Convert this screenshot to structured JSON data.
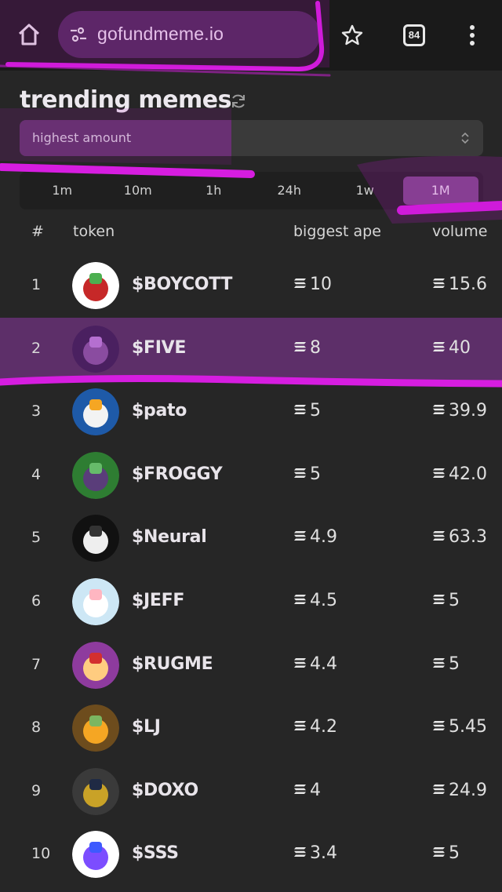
{
  "browser": {
    "url": "gofundmeme.io",
    "tab_count": "84",
    "icons": [
      "home-icon",
      "tune-icon",
      "star-icon",
      "tabs-icon",
      "more-vert-icon"
    ]
  },
  "page": {
    "title": "trending memes",
    "sort_select": {
      "value": "highest amount"
    },
    "timeframes": [
      "1m",
      "10m",
      "1h",
      "24h",
      "1w",
      "1M"
    ],
    "active_timeframe": "1M"
  },
  "table": {
    "headers": {
      "rank": "#",
      "token": "token",
      "ape": "biggest ape",
      "volume": "volume"
    },
    "rows": [
      {
        "rank": "1",
        "name": "$BOYCOTT",
        "ape": "10",
        "volume": "15.6"
      },
      {
        "rank": "2",
        "name": "$FIVE",
        "ape": "8",
        "volume": "40"
      },
      {
        "rank": "3",
        "name": "$pato",
        "ape": "5",
        "volume": "39.9"
      },
      {
        "rank": "4",
        "name": "$FROGGY",
        "ape": "5",
        "volume": "42.0"
      },
      {
        "rank": "5",
        "name": "$Neural",
        "ape": "4.9",
        "volume": "63.3"
      },
      {
        "rank": "6",
        "name": "$JEFF",
        "ape": "4.5",
        "volume": "5"
      },
      {
        "rank": "7",
        "name": "$RUGME",
        "ape": "4.4",
        "volume": "5"
      },
      {
        "rank": "8",
        "name": "$LJ",
        "ape": "4.2",
        "volume": "5.45"
      },
      {
        "rank": "9",
        "name": "$DOXO",
        "ape": "4",
        "volume": "24.9"
      },
      {
        "rank": "10",
        "name": "$SSS",
        "ape": "3.4",
        "volume": "5"
      }
    ],
    "highlighted_rank": "2"
  },
  "colors": {
    "background": "#262626",
    "accent_purple": "#7a4a86",
    "highlight_row": "#5d2f69",
    "annotation_magenta": "#d61de0"
  }
}
